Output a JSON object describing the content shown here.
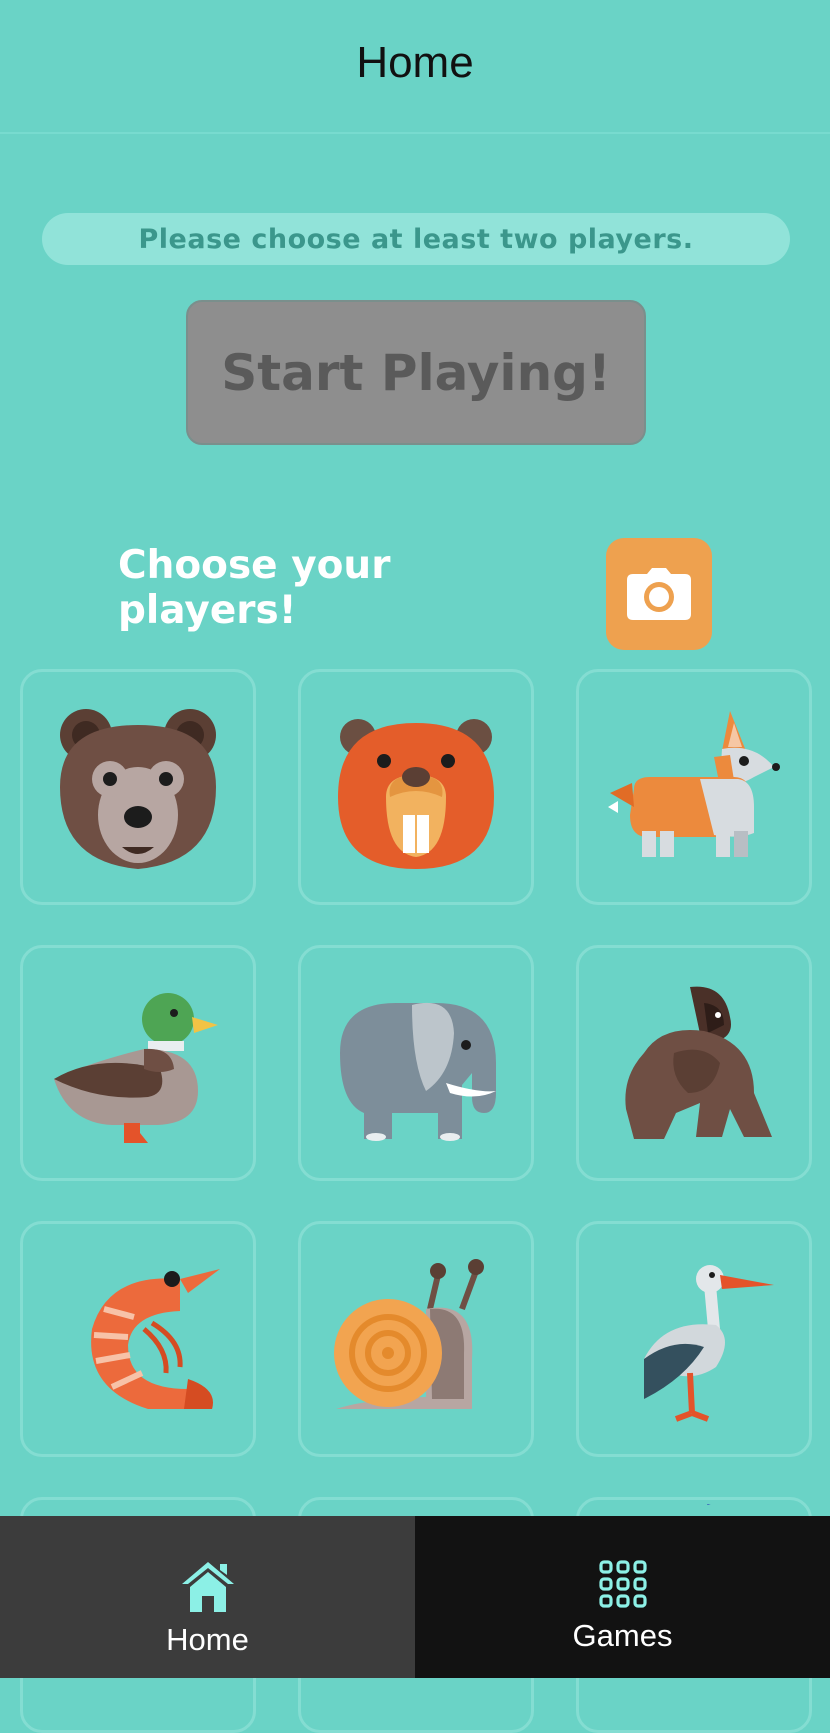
{
  "header": {
    "title": "Home"
  },
  "notice": {
    "text": "Please choose at least two players."
  },
  "start_button": {
    "label": "Start Playing!"
  },
  "players_section": {
    "label": "Choose your players!",
    "camera_icon": "camera-icon"
  },
  "players": [
    {
      "animal": "bear"
    },
    {
      "animal": "beaver"
    },
    {
      "animal": "corgi"
    },
    {
      "animal": "duck"
    },
    {
      "animal": "elephant"
    },
    {
      "animal": "gorilla"
    },
    {
      "animal": "shrimp"
    },
    {
      "animal": "snail"
    },
    {
      "animal": "stork"
    },
    {
      "animal": "partially-visible"
    },
    {
      "animal": "partially-visible"
    },
    {
      "animal": "partially-visible"
    }
  ],
  "bottom_nav": {
    "items": [
      {
        "label": "Home",
        "icon": "home-icon",
        "active": true
      },
      {
        "label": "Games",
        "icon": "grid-icon",
        "active": false
      }
    ]
  },
  "colors": {
    "background": "#6ad3c6",
    "accent": "#8cf0e6",
    "camera": "#eea14f",
    "disabled_button": "#8e8e8e"
  }
}
